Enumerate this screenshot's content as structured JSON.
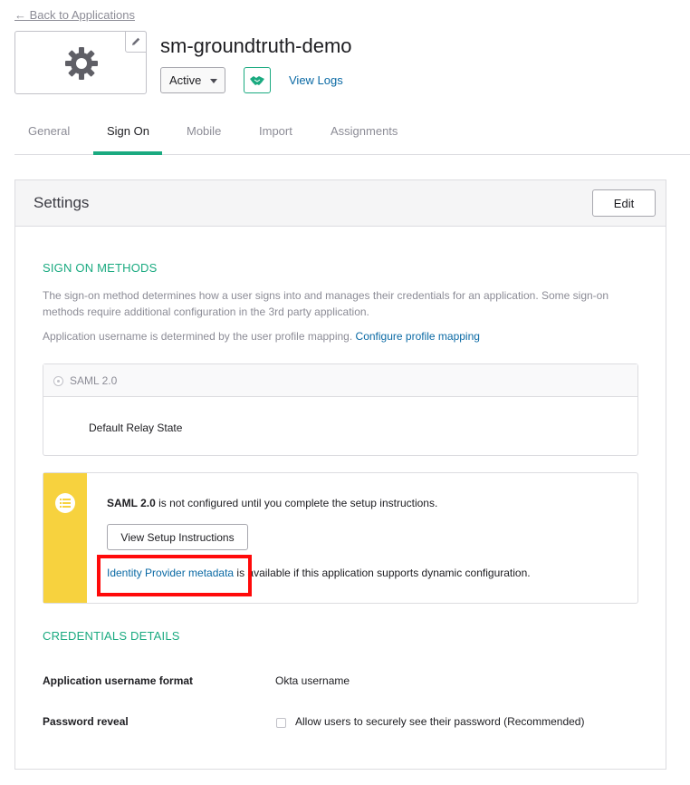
{
  "nav": {
    "back_label": "← Back to Applications"
  },
  "app": {
    "title": "sm-groundtruth-demo",
    "status": "Active",
    "view_logs": "View Logs",
    "logo_icon": "gear-icon",
    "accent_color": "#1aaa80"
  },
  "tabs": [
    {
      "label": "General"
    },
    {
      "label": "Sign On",
      "active": true
    },
    {
      "label": "Mobile"
    },
    {
      "label": "Import"
    },
    {
      "label": "Assignments"
    }
  ],
  "settings": {
    "title": "Settings",
    "edit_label": "Edit",
    "sign_on_methods": {
      "heading": "SIGN ON METHODS",
      "description": "The sign-on method determines how a user signs into and manages their credentials for an application. Some sign-on methods require additional configuration in the 3rd party application.",
      "username_text": "Application username is determined by the user profile mapping.",
      "username_link": "Configure profile mapping",
      "method_label": "SAML 2.0",
      "relay_state_label": "Default Relay State"
    },
    "notice": {
      "bold": "SAML 2.0",
      "text": " is not configured until you complete the setup instructions.",
      "button_label": "View Setup Instructions",
      "idp_link": "Identity Provider metadata",
      "idp_text": " is available if this application supports dynamic configuration.",
      "stripe_color": "#f7d23e"
    },
    "credentials": {
      "heading": "CREDENTIALS DETAILS",
      "username_format_label": "Application username format",
      "username_format_value": "Okta username",
      "password_reveal_label": "Password reveal",
      "password_reveal_option": "Allow users to securely see their password (Recommended)"
    }
  }
}
